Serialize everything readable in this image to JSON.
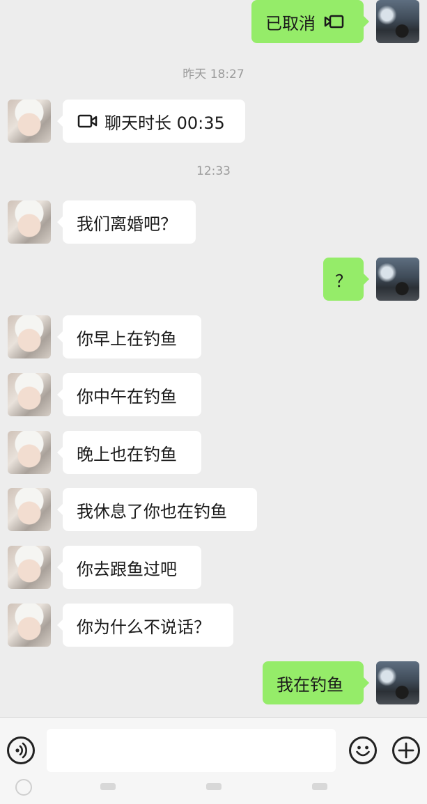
{
  "messages": [
    {
      "side": "out",
      "type": "call",
      "text": "已取消"
    },
    {
      "side": "time",
      "text": "昨天 18:27"
    },
    {
      "side": "in",
      "type": "call",
      "text": "聊天时长 00:35"
    },
    {
      "side": "time",
      "text": "12:33"
    },
    {
      "side": "in",
      "text": "我们离婚吧？"
    },
    {
      "side": "out",
      "text": "？"
    },
    {
      "side": "in",
      "text": "你早上在钓鱼"
    },
    {
      "side": "in",
      "text": "你中午在钓鱼"
    },
    {
      "side": "in",
      "text": "晚上也在钓鱼"
    },
    {
      "side": "in",
      "text": "我休息了你也在钓鱼"
    },
    {
      "side": "in",
      "text": "你去跟鱼过吧"
    },
    {
      "side": "in",
      "text": "你为什么不说话？"
    },
    {
      "side": "out",
      "text": "我在钓鱼"
    }
  ],
  "input": {
    "placeholder": ""
  },
  "icons": {
    "voice": "voice-input-icon",
    "emoji": "emoji-icon",
    "plus": "add-more-icon",
    "video": "video-call-icon"
  },
  "colors": {
    "outgoing_bubble": "#95ec69",
    "incoming_bubble": "#ffffff",
    "background": "#ededed"
  }
}
